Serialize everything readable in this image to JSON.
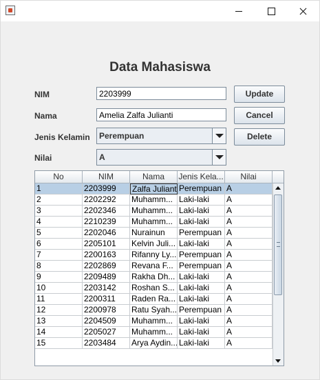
{
  "window": {
    "controls": {
      "minimize": "minimize-icon",
      "maximize": "maximize-icon",
      "close": "close-icon"
    }
  },
  "form": {
    "title": "Data Mahasiswa",
    "nim_label": "NIM",
    "nim_value": "2203999",
    "nama_label": "Nama",
    "nama_value": "Amelia Zalfa Julianti",
    "jenis_kelamin_label": "Jenis Kelamin",
    "jenis_kelamin_value": "Perempuan",
    "nilai_label": "Nilai",
    "nilai_value": "A"
  },
  "buttons": {
    "update": "Update",
    "cancel": "Cancel",
    "delete": "Delete"
  },
  "table": {
    "columns": [
      "No",
      "NIM",
      "Nama",
      "Jenis Kela...",
      "Nilai"
    ],
    "selected_row": 0,
    "rows": [
      [
        "1",
        "2203999",
        "Zalfa Julianti",
        "Perempuan",
        "A"
      ],
      [
        "2",
        "2202292",
        "Muhamm...",
        "Laki-laki",
        "A"
      ],
      [
        "3",
        "2202346",
        "Muhamm...",
        "Laki-laki",
        "A"
      ],
      [
        "4",
        "2210239",
        "Muhamm...",
        "Laki-laki",
        "A"
      ],
      [
        "5",
        "2202046",
        "Nurainun",
        "Perempuan",
        "A"
      ],
      [
        "6",
        "2205101",
        "Kelvin Juli...",
        "Laki-laki",
        "A"
      ],
      [
        "7",
        "2200163",
        "Rifanny Ly...",
        "Perempuan",
        "A"
      ],
      [
        "8",
        "2202869",
        "Revana F...",
        "Perempuan",
        "A"
      ],
      [
        "9",
        "2209489",
        "Rakha Dh...",
        "Laki-laki",
        "A"
      ],
      [
        "10",
        "2203142",
        "Roshan S...",
        "Laki-laki",
        "A"
      ],
      [
        "11",
        "2200311",
        "Raden Ra...",
        "Laki-laki",
        "A"
      ],
      [
        "12",
        "2200978",
        "Ratu Syah...",
        "Perempuan",
        "A"
      ],
      [
        "13",
        "2204509",
        "Muhamm...",
        "Laki-laki",
        "A"
      ],
      [
        "14",
        "2205027",
        "Muhamm...",
        "Laki-laki",
        "A"
      ],
      [
        "15",
        "2203484",
        "Arya Aydin...",
        "Laki-laki",
        "A"
      ]
    ]
  },
  "colors": {
    "selection": "#b8cfe5",
    "panel": "#f0f0f0",
    "border": "#7a8a99"
  }
}
